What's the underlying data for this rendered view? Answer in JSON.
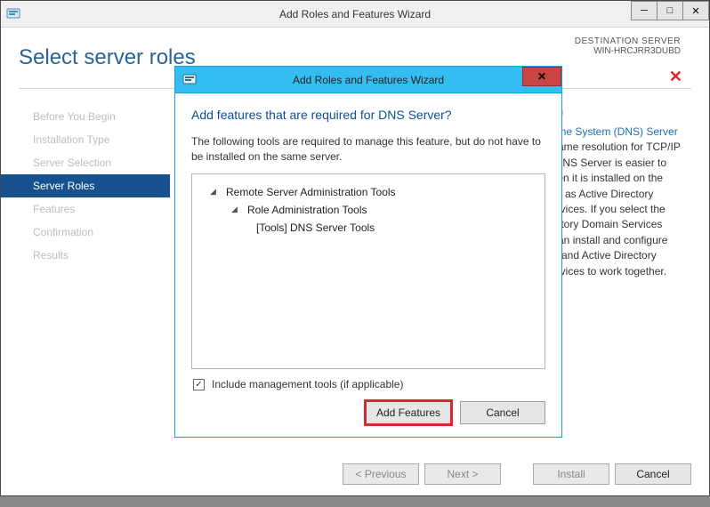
{
  "parent_window": {
    "title": "Add Roles and Features Wizard",
    "controls": {
      "minimize": "─",
      "maximize": "□",
      "close": "✕"
    },
    "page_heading": "Select server roles",
    "destination": {
      "label": "DESTINATION SERVER",
      "server": "WIN-HRCJRR3DUBD"
    },
    "steps": [
      "Before You Begin",
      "Installation Type",
      "Server Selection",
      "Server Roles",
      "Features",
      "Confirmation",
      "Results"
    ],
    "active_step_index": 3,
    "description_title": "tion",
    "description_body_lines": [
      {
        "link": "Name System (DNS) Server",
        "tail": ""
      },
      "s name resolution for TCP/IP",
      "s. DNS Server is easier to",
      "when it is installed on the",
      "rver as Active Directory",
      "Services. If you select the",
      "irectory Domain Services",
      "u can install and configure",
      "ver and Active Directory",
      "Services to work together."
    ],
    "buttons": {
      "previous": "< Previous",
      "next": "Next >",
      "install": "Install",
      "cancel": "Cancel"
    }
  },
  "dialog": {
    "title": "Add Roles and Features Wizard",
    "close_glyph": "✕",
    "heading": "Add features that are required for DNS Server?",
    "description": "The following tools are required to manage this feature, but do not have to be installed on the same server.",
    "tree": {
      "l1": "Remote Server Administration Tools",
      "l2": "Role Administration Tools",
      "l3": "[Tools] DNS Server Tools"
    },
    "include_label": "Include management tools (if applicable)",
    "include_checked": true,
    "buttons": {
      "add": "Add Features",
      "cancel": "Cancel"
    }
  }
}
